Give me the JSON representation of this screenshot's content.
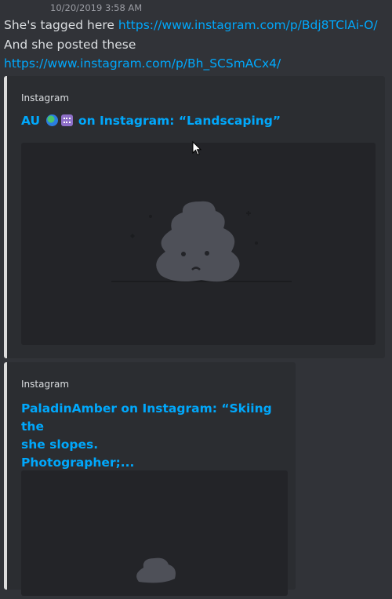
{
  "message": {
    "timestamp": "10/20/2019 3:58 AM",
    "line1_text": "She's tagged here ",
    "line1_link": "https://www.instagram.com/p/Bdj8TClAi-O/",
    "line2_text": "And she posted these",
    "line3_link": "https://www.instagram.com/p/Bh_SCSmACx4/"
  },
  "embeds": [
    {
      "provider": "Instagram",
      "title_prefix": "AU",
      "title_suffix": "on Instagram: “Landscaping”",
      "image_icon": "broken-image-poop-icon"
    },
    {
      "provider": "Instagram",
      "title_lines": [
        "PaladinAmber on Instagram: “Skiing the",
        "she slopes.",
        "Photographer;..."
      ],
      "image_icon": "broken-image-poop-icon"
    }
  ],
  "colors": {
    "background": "#313338",
    "embed_bg": "#2b2d31",
    "link": "#00a8fc",
    "text": "#dbdee1"
  }
}
